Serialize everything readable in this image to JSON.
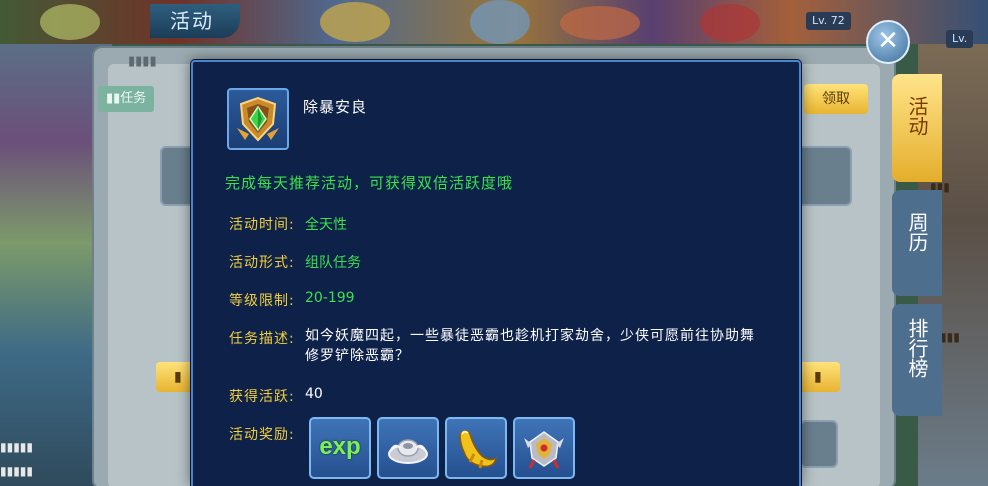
{
  "header": {
    "title": "活动",
    "close_symbol": "✕",
    "level_badge_1": "Lv. 72",
    "level_badge_2": "Lv."
  },
  "side_tabs": [
    {
      "label": "活动",
      "active": true
    },
    {
      "label": "周历",
      "active": false
    },
    {
      "label": "排行榜",
      "active": false
    }
  ],
  "background_panel": {
    "claim_button": "领取"
  },
  "dialog": {
    "icon": "diamond-crest-icon",
    "title": "除暴安良",
    "description": "完成每天推荐活动，可获得双倍活跃度哦",
    "rows": [
      {
        "label": "活动时间:",
        "value": "全天性"
      },
      {
        "label": "活动形式:",
        "value": "组队任务"
      },
      {
        "label": "等级限制:",
        "value": "20-199"
      }
    ],
    "task": {
      "label": "任务描述:",
      "text": "如今妖魔四起，一些暴徒恶霸也趁机打家劫舍，少侠可愿前往协助舞修罗铲除恶霸？"
    },
    "activity": {
      "label": "获得活跃:",
      "value": "40"
    },
    "rewards": {
      "label": "活动奖励:",
      "items": [
        {
          "icon": "exp-icon",
          "text": "exp"
        },
        {
          "icon": "silver-ingot-icon"
        },
        {
          "icon": "golden-dragon-icon"
        },
        {
          "icon": "helmet-crest-icon"
        }
      ]
    }
  },
  "colors": {
    "dialog_bg": "#0d2149",
    "dialog_border": "#4c84c8",
    "label_yellow": "#f1cf3b",
    "value_green": "#3ce04d",
    "active_tab": "#e4ae2c"
  }
}
